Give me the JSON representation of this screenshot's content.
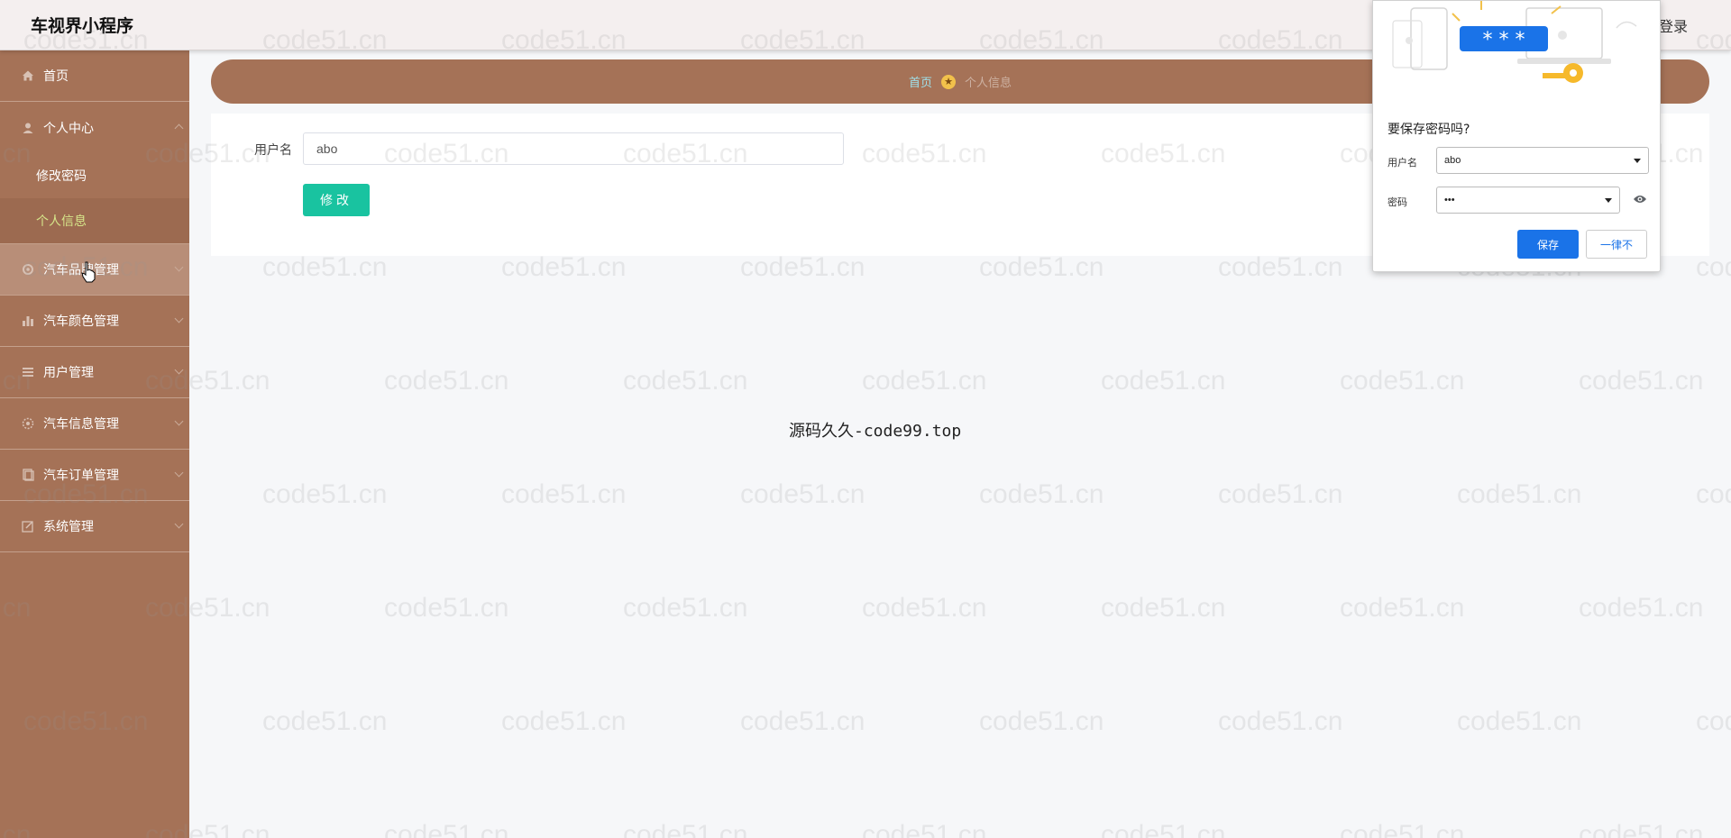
{
  "header": {
    "app_title": "车视界小程序",
    "login_label": "登录"
  },
  "sidebar": {
    "items": [
      {
        "label": "首页",
        "icon": "home-icon"
      },
      {
        "label": "个人中心",
        "icon": "user-icon",
        "expanded": true,
        "children": [
          {
            "label": "修改密码"
          },
          {
            "label": "个人信息",
            "current": true
          }
        ]
      },
      {
        "label": "汽车品牌管理",
        "icon": "gear-icon",
        "hovered": true
      },
      {
        "label": "汽车颜色管理",
        "icon": "bar-chart-icon"
      },
      {
        "label": "用户管理",
        "icon": "list-icon"
      },
      {
        "label": "汽车信息管理",
        "icon": "settings-icon"
      },
      {
        "label": "汽车订单管理",
        "icon": "document-icon"
      },
      {
        "label": "系统管理",
        "icon": "edit-icon"
      }
    ]
  },
  "breadcrumb": {
    "home": "首页",
    "separator_icon": "star-icon",
    "current": "个人信息"
  },
  "form": {
    "username_label": "用户名",
    "username_value": "abo",
    "submit_label": "修改"
  },
  "footer_text": "源码久久-code99.top",
  "watermark_text": "code51.cn",
  "save_password_popup": {
    "title": "要保存密码吗?",
    "masked_badge": "* * *",
    "username_label": "用户名",
    "username_value": "abo",
    "password_label": "密码",
    "password_value": "•••",
    "save_label": "保存",
    "never_label": "一律不"
  },
  "colors": {
    "sidebar": "#a57257",
    "accent_green": "#19c3a0",
    "chrome_blue": "#1a73e8"
  }
}
